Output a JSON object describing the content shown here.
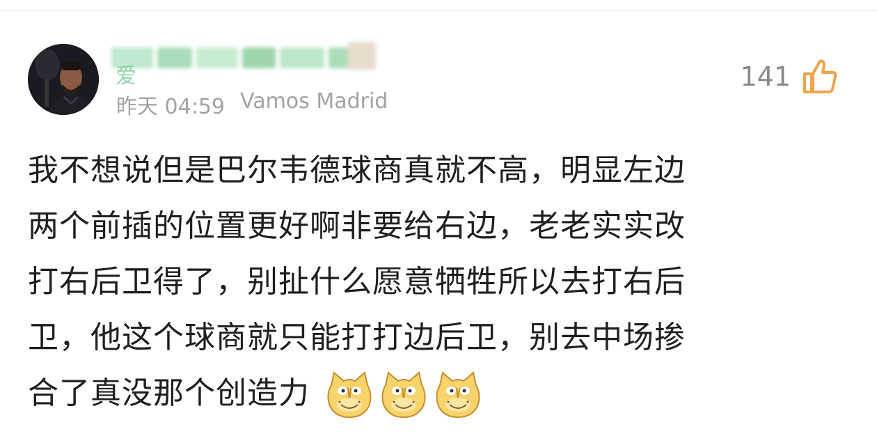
{
  "post": {
    "username_visible_char": "爱",
    "timestamp": "昨天 04:59",
    "source": "Vamos Madrid",
    "like_count": "141",
    "comment_lines": [
      "我不想说但是巴尔韦德球商真就不高，明显左边",
      "两个前插的位置更好啊非要给右边，老老实实改",
      "打右后卫得了，别扯什么愿意牺牲所以去打右后",
      "卫，他这个球商就只能打打边后卫，别去中场掺",
      "合了真没那个创造力"
    ],
    "emoji": [
      "doge-cat-emoji",
      "doge-cat-emoji",
      "doge-cat-emoji"
    ]
  },
  "colors": {
    "username_green": "#3fb86e",
    "meta_gray": "#a3a3a3",
    "like_orange": "#f2a24a",
    "text": "#1f1f1f"
  }
}
